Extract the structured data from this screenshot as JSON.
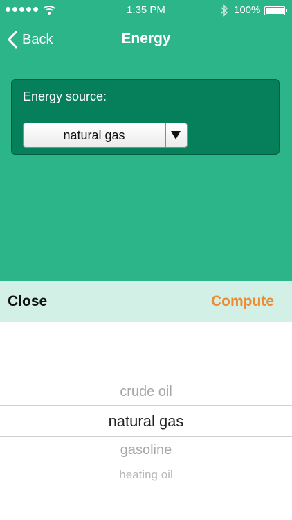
{
  "status_bar": {
    "time": "1:35 PM",
    "battery_percent": "100%",
    "icons": [
      "signal-dots-icon",
      "wifi-icon",
      "bluetooth-icon",
      "battery-icon"
    ]
  },
  "nav": {
    "back_label": "Back",
    "title": "Energy"
  },
  "form": {
    "energy_label": "Energy source:",
    "selected_source": "natural gas"
  },
  "toolbar": {
    "close_label": "Close",
    "compute_label": "Compute"
  },
  "picker": {
    "items": [
      "crude oil",
      "natural gas",
      "gasoline",
      "heating oil"
    ],
    "selected_index": 1
  },
  "colors": {
    "primary": "#2db58a",
    "card": "#05805a",
    "toolbar": "#d2f0e6",
    "accent": "#ef8a2e"
  }
}
